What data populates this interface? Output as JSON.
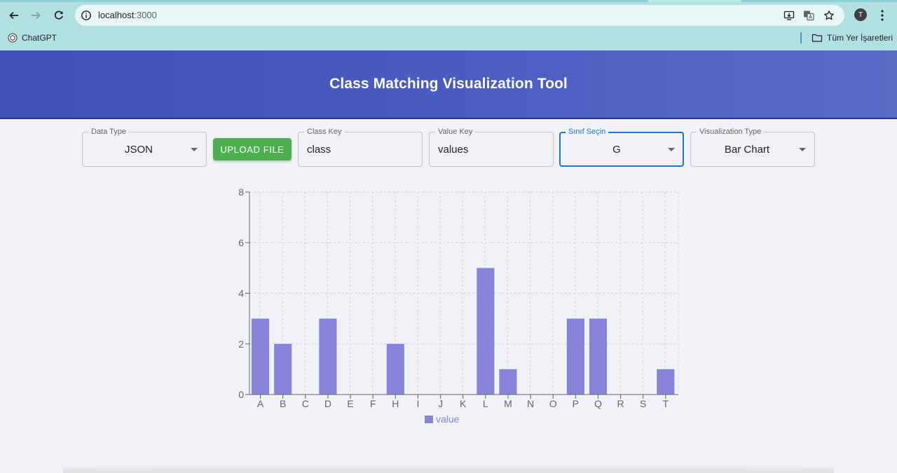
{
  "browser": {
    "url_host": "localhost",
    "url_port": ":3000",
    "profile_initial": "T",
    "bookmarks": [
      {
        "label": "ChatGPT",
        "icon": "chatgpt-icon"
      },
      {
        "label": "Tüm Yer İşaretleri",
        "icon": "folder-icon"
      }
    ]
  },
  "app": {
    "title": "Class Matching Visualization Tool"
  },
  "controls": {
    "data_type": {
      "label": "Data Type",
      "value": "JSON"
    },
    "upload_label": "UPLOAD FILE",
    "class_key": {
      "label": "Class Key",
      "value": "class"
    },
    "value_key": {
      "label": "Value Key",
      "value": "values"
    },
    "class_select": {
      "label": "Sınıf Seçin",
      "value": "G"
    },
    "viz_type": {
      "label": "Visualization Type",
      "value": "Bar Chart"
    }
  },
  "colors": {
    "bar": "#8884d8",
    "header_start": "#3f51b5",
    "accent": "#1976d2",
    "upload": "#4caf50"
  },
  "chart_data": {
    "type": "bar",
    "categories": [
      "A",
      "B",
      "C",
      "D",
      "E",
      "F",
      "H",
      "I",
      "J",
      "K",
      "L",
      "M",
      "N",
      "O",
      "P",
      "Q",
      "R",
      "S",
      "T"
    ],
    "series": [
      {
        "name": "value",
        "values": [
          3,
          2,
          0,
          3,
          0,
          0,
          2,
          0,
          0,
          0,
          5,
          1,
          0,
          0,
          3,
          3,
          0,
          0,
          1
        ]
      }
    ],
    "yticks": [
      0,
      2,
      4,
      6,
      8
    ],
    "ylim": [
      0,
      8
    ],
    "grid": true,
    "legend_position": "bottom"
  }
}
